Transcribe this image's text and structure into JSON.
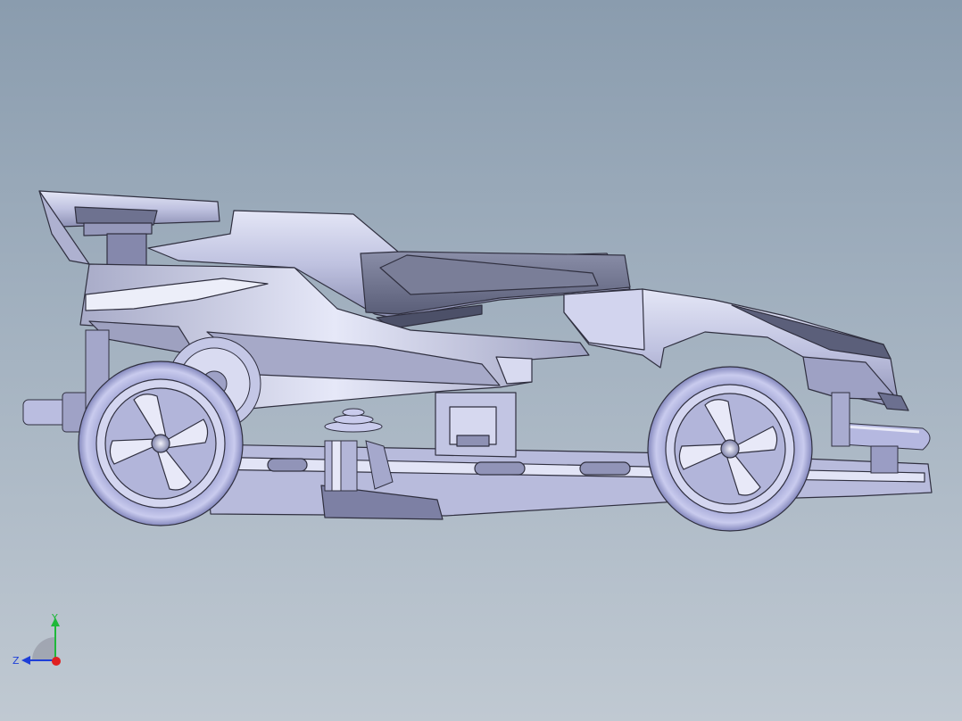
{
  "viewport": {
    "background_top": "#8a9cae",
    "background_bottom": "#c0c9d2"
  },
  "model": {
    "body_color": "#c5c8e6",
    "edge_color": "#303040"
  },
  "triad": {
    "y_label": "Y",
    "z_label": "Z",
    "y_color": "#1fb83a",
    "z_color": "#1e3fd8",
    "x_color": "#e02020"
  }
}
